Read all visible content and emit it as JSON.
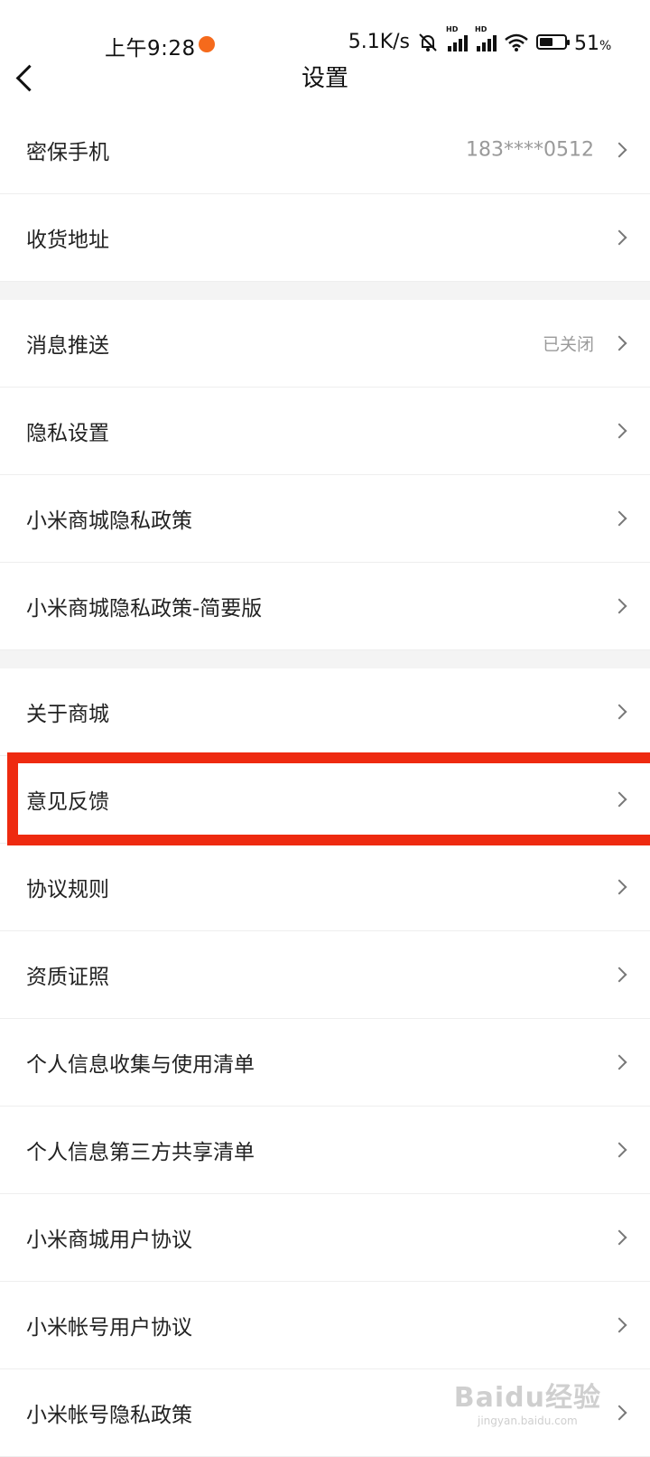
{
  "status_bar": {
    "time": "上午9:28",
    "net_speed": "5.1K/s",
    "battery_percent": "51",
    "battery_unit": "%",
    "icons": [
      "mute-icon",
      "signal-hd-icon",
      "signal-hd-icon",
      "wifi-icon",
      "battery-icon"
    ]
  },
  "header": {
    "title": "设置"
  },
  "sections": [
    {
      "items": [
        {
          "label": "密保手机",
          "value": "183****0512"
        },
        {
          "label": "收货地址",
          "value": ""
        }
      ]
    },
    {
      "items": [
        {
          "label": "消息推送",
          "value": "已关闭"
        },
        {
          "label": "隐私设置",
          "value": ""
        },
        {
          "label": "小米商城隐私政策",
          "value": ""
        },
        {
          "label": "小米商城隐私政策-简要版",
          "value": ""
        }
      ]
    },
    {
      "items": [
        {
          "label": "关于商城",
          "value": ""
        },
        {
          "label": "意见反馈",
          "value": ""
        },
        {
          "label": "协议规则",
          "value": ""
        },
        {
          "label": "资质证照",
          "value": ""
        },
        {
          "label": "个人信息收集与使用清单",
          "value": ""
        },
        {
          "label": "个人信息第三方共享清单",
          "value": ""
        },
        {
          "label": "小米商城用户协议",
          "value": ""
        },
        {
          "label": "小米帐号用户协议",
          "value": ""
        },
        {
          "label": "小米帐号隐私政策",
          "value": ""
        }
      ]
    }
  ],
  "highlighted_item": "意见反馈",
  "watermark": {
    "brand": "Baidu经验",
    "url": "jingyan.baidu.com"
  },
  "colors": {
    "highlight": "#ee2a10",
    "notification_dot": "#f56a1c",
    "section_gap": "#f4f4f4"
  }
}
